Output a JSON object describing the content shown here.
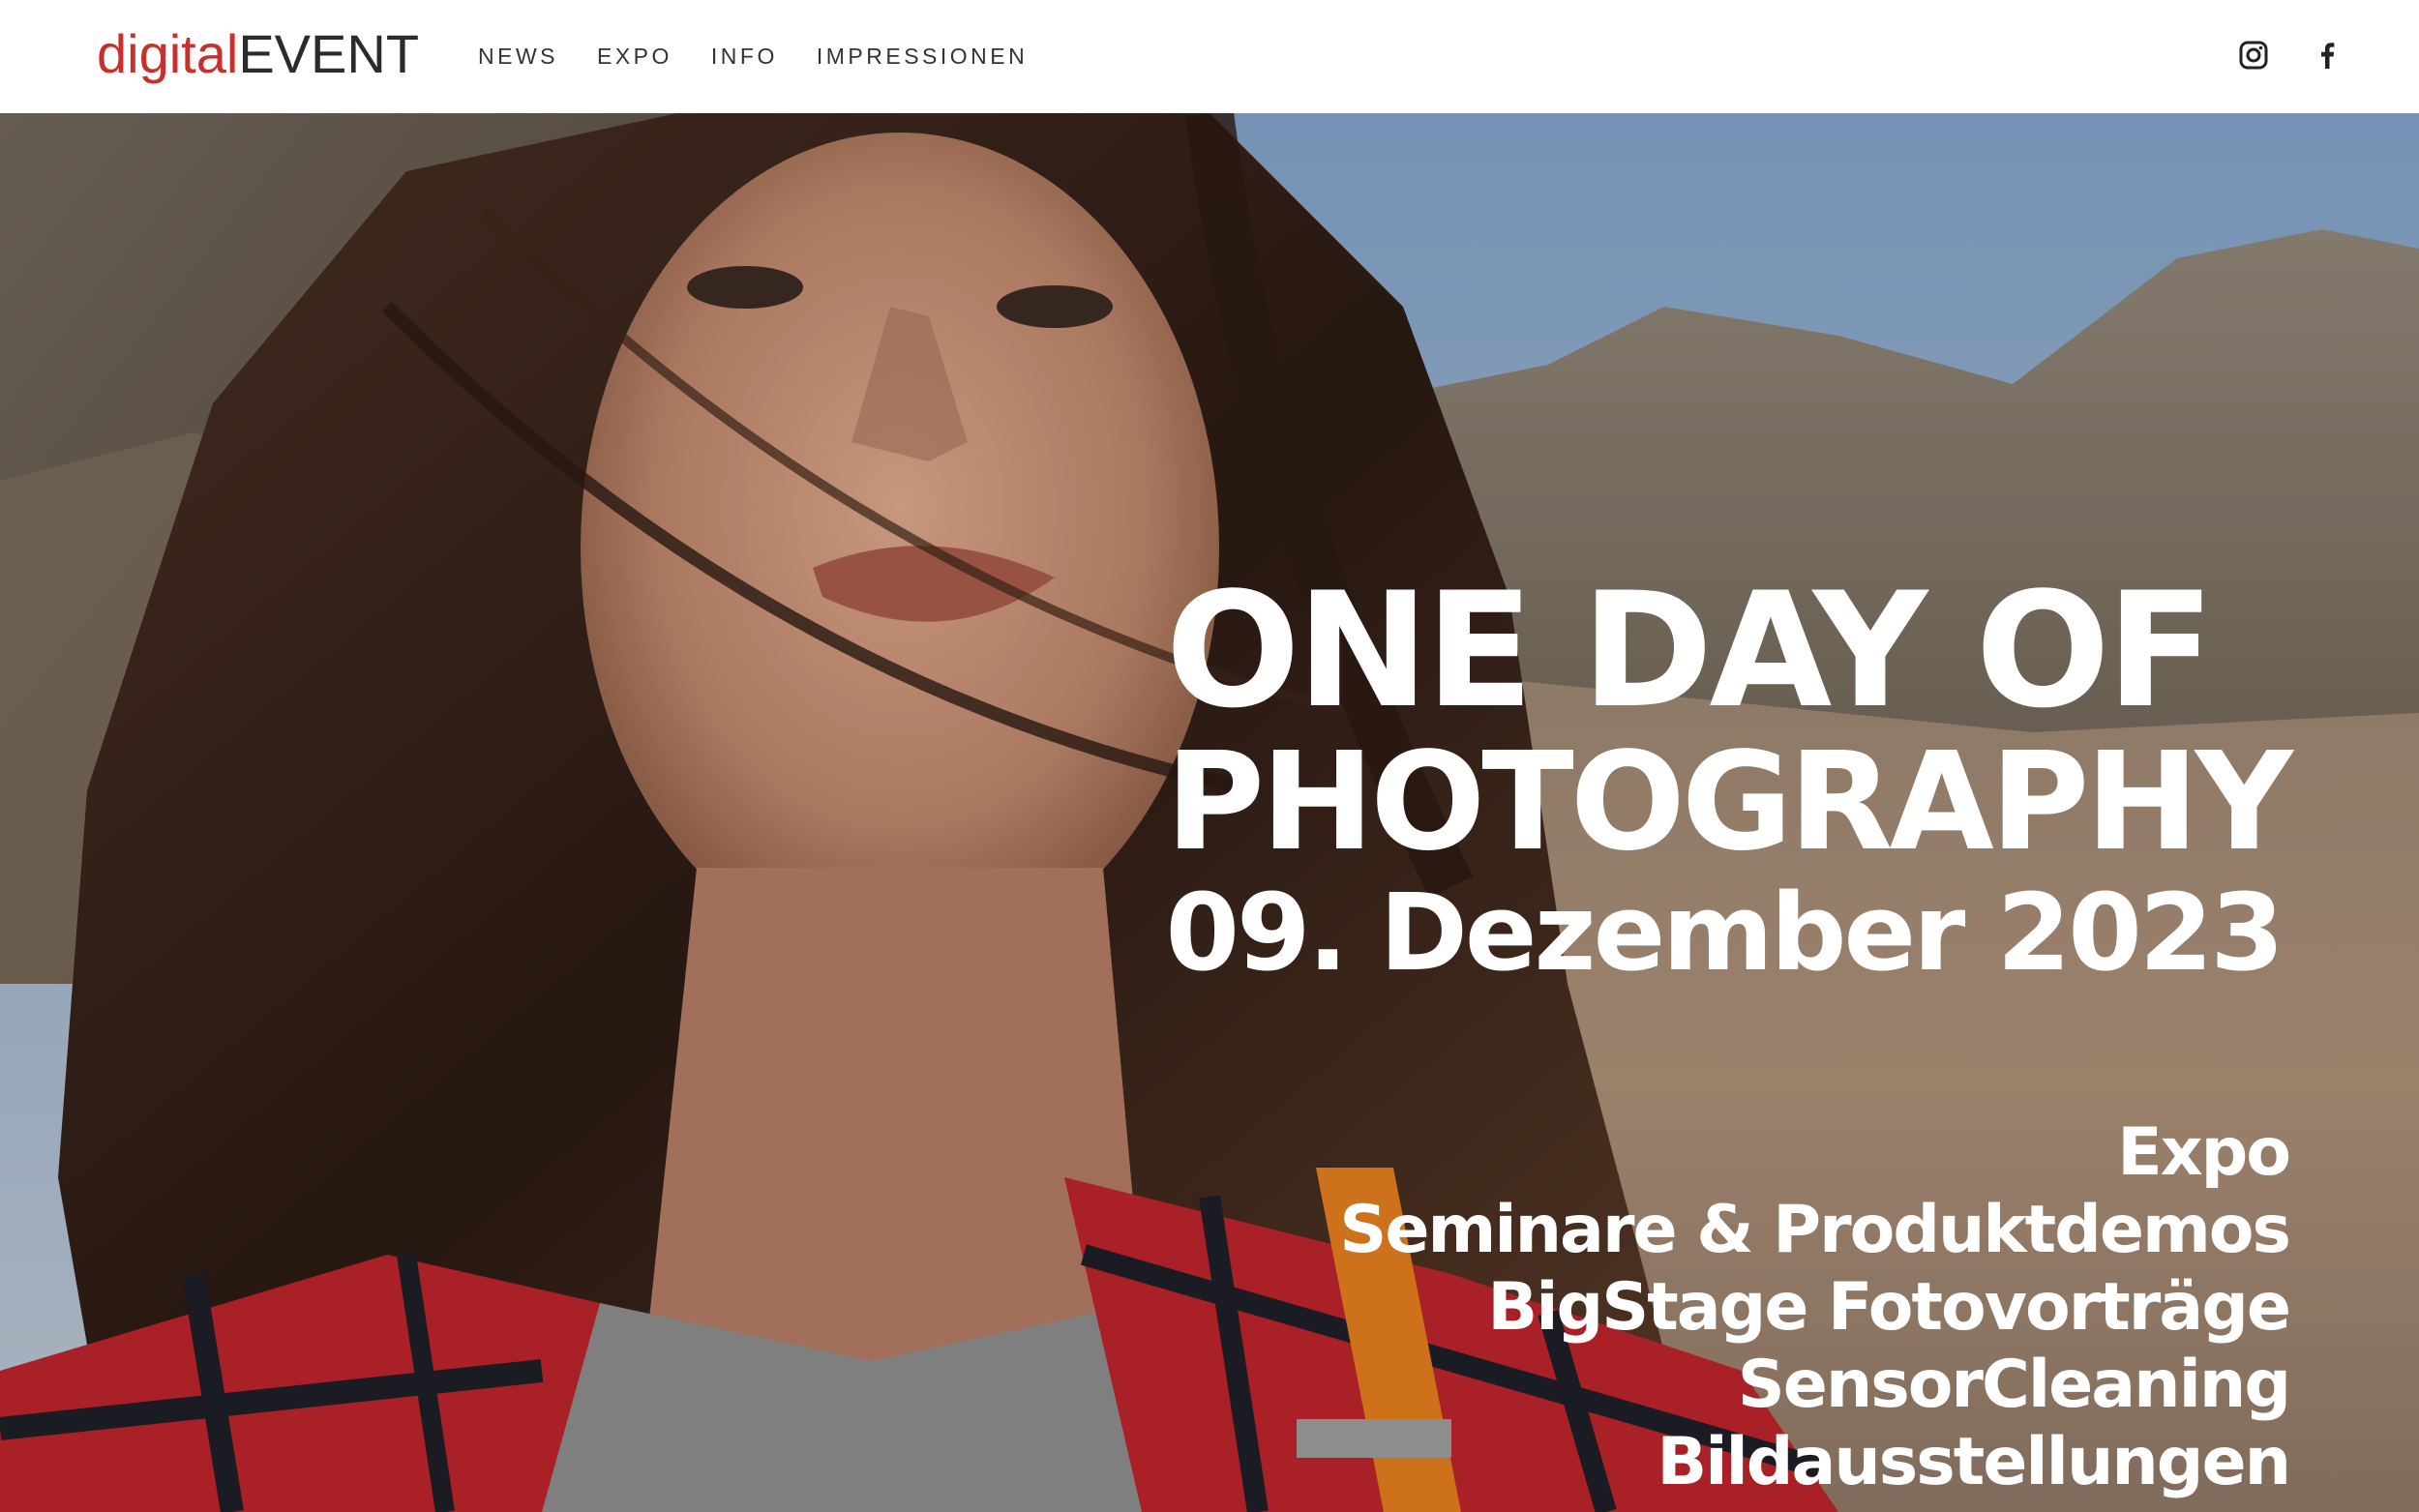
{
  "header": {
    "logo": {
      "part_a": "digital",
      "part_b": "EVENT"
    },
    "nav": [
      {
        "label": "NEWS"
      },
      {
        "label": "EXPO"
      },
      {
        "label": "INFO"
      },
      {
        "label": "IMPRESSIONEN"
      }
    ],
    "social": [
      {
        "icon": "instagram-icon"
      },
      {
        "icon": "facebook-icon"
      }
    ]
  },
  "hero": {
    "headline_line1": "ONE DAY OF",
    "headline_line2": "PHOTOGRAPHY",
    "date": "09. Dezember 2023",
    "features": [
      "Expo",
      "Seminare & Produktdemos",
      "BigStage Fotovorträge",
      "SensorCleaning",
      "Bildausstellungen"
    ]
  },
  "colors": {
    "logo_accent": "#c9302c",
    "logo_dark": "#2b2b2b",
    "nav_text": "#333333",
    "hero_text": "#ffffff"
  }
}
